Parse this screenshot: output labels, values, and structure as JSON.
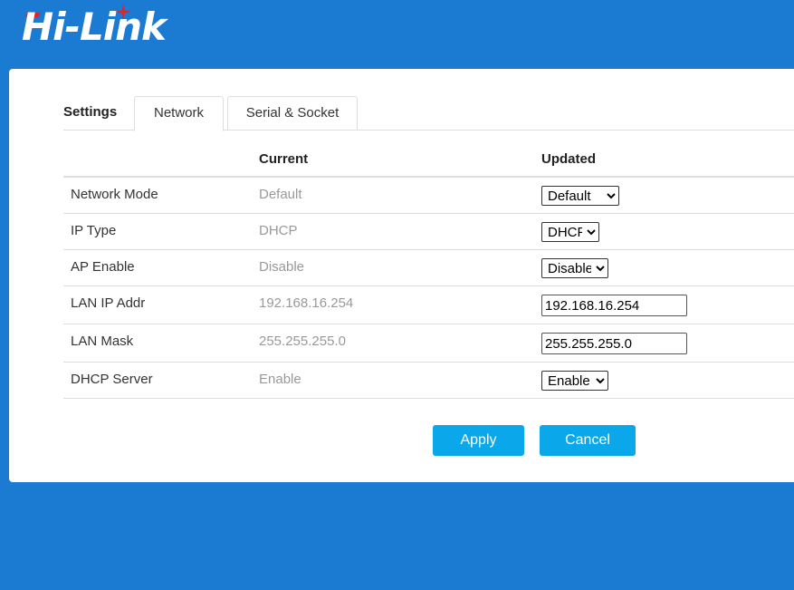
{
  "brand": {
    "logo_text": "Hi-Link",
    "background_color": "#1b7ad2",
    "accent_color": "#e0242b",
    "button_color": "#0aa8ea"
  },
  "tabs": {
    "title": "Settings",
    "items": [
      {
        "label": "Network",
        "active": true
      },
      {
        "label": "Serial & Socket",
        "active": false
      }
    ]
  },
  "table": {
    "headers": {
      "label": "",
      "current": "Current",
      "updated": "Updated"
    },
    "rows": [
      {
        "label": "Network Mode",
        "current": "Default",
        "updated": "Default",
        "control": "select",
        "options": [
          "Default"
        ]
      },
      {
        "label": "IP Type",
        "current": "DHCP",
        "updated": "DHCP",
        "control": "select",
        "options": [
          "DHCP"
        ]
      },
      {
        "label": "AP Enable",
        "current": "Disable",
        "updated": "Disable",
        "control": "select",
        "options": [
          "Disable"
        ]
      },
      {
        "label": "LAN IP Addr",
        "current": "192.168.16.254",
        "updated": "192.168.16.254",
        "control": "input"
      },
      {
        "label": "LAN Mask",
        "current": "255.255.255.0",
        "updated": "255.255.255.0",
        "control": "input"
      },
      {
        "label": "DHCP Server",
        "current": "Enable",
        "updated": "Enable",
        "control": "select",
        "options": [
          "Enable"
        ]
      }
    ]
  },
  "actions": {
    "apply_label": "Apply",
    "cancel_label": "Cancel"
  }
}
